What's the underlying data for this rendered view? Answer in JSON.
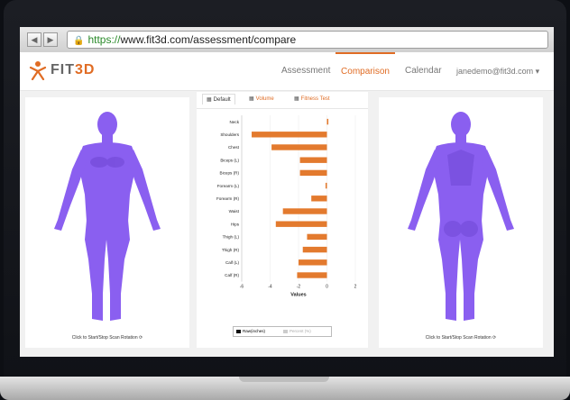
{
  "browser": {
    "url_scheme": "https://",
    "url_rest": "www.fit3d.com/assessment/compare",
    "back_glyph": "◀",
    "forward_glyph": "▶",
    "lock_glyph": "🔒"
  },
  "header": {
    "logo_main": "FIT",
    "logo_accent": "3D",
    "nav": [
      "Assessment",
      "Comparison",
      "Calendar",
      "janedemo@fit3d.com ▾"
    ],
    "active_nav": "Comparison"
  },
  "tabs": [
    {
      "label": "Default",
      "icon": "grid-icon"
    },
    {
      "label": "Volume",
      "icon": "grid-icon"
    },
    {
      "label": "Fitness Test",
      "icon": "grid-icon"
    }
  ],
  "left_panel": {
    "rotation_label": "Click to Start/Stop Scan Rotation ⟳"
  },
  "right_panel": {
    "rotation_label": "Click to Start/Stop Scan Rotation ⟳"
  },
  "colors": {
    "accent": "#e06c24",
    "bar": "#e37a2e",
    "body": "#8a5ff0"
  },
  "chart_data": {
    "type": "bar",
    "orientation": "horizontal",
    "categories": [
      "Neck",
      "Shoulders",
      "Chest",
      "Biceps (L)",
      "Biceps (R)",
      "Forearm (L)",
      "Forearm (R)",
      "Waist",
      "Hips",
      "Thigh (L)",
      "Thigh (R)",
      "Calf (L)",
      "Calf (R)"
    ],
    "values": [
      0.1,
      -5.3,
      -3.9,
      -1.9,
      -1.9,
      -0.1,
      -1.1,
      -3.1,
      -3.6,
      -1.4,
      -1.7,
      -2.0,
      -2.1
    ],
    "xlabel": "Values",
    "xlim": [
      -6,
      2
    ],
    "xticks": [
      "-6",
      "-4",
      "-2",
      "0",
      "2"
    ],
    "legend": [
      "Raw(inches)",
      "Percent (%)"
    ]
  }
}
